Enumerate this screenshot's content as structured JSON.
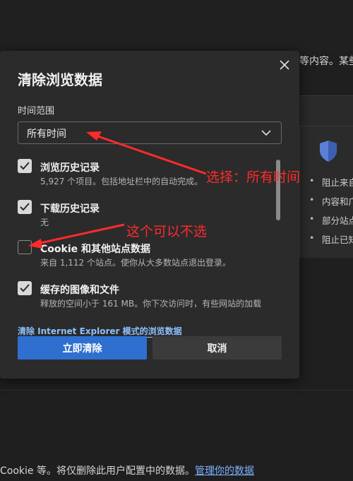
{
  "background": {
    "intro_text": "等内容。某些",
    "list_items": [
      "阻止来自",
      "内容和广",
      "部分站点",
      "阻止已知"
    ],
    "footer_text": "Cookie 等。将仅删除此用户配置中的数据。",
    "footer_link": "管理你的数据"
  },
  "dialog": {
    "title": "清除浏览数据",
    "time_range_label": "时间范围",
    "time_range_value": "所有时间",
    "items": [
      {
        "title": "浏览历史记录",
        "desc": "5,927 个项目。包括地址栏中的自动完成。",
        "checked": true
      },
      {
        "title": "下载历史记录",
        "desc": "无",
        "checked": true
      },
      {
        "title": "Cookie 和其他站点数据",
        "desc": "来自 1,112 个站点。使你从大多数站点退出登录。",
        "checked": false
      },
      {
        "title": "缓存的图像和文件",
        "desc": "释放的空间小于 161 MB。你下次访问时，有些网站的加载",
        "checked": true
      }
    ],
    "ie_link": "清除 Internet Explorer 模式的浏览数据",
    "clear_button": "立即清除",
    "cancel_button": "取消"
  },
  "annotations": {
    "select_all_time": "选择：所有时间",
    "no_need": "这个可以不选",
    "color": "#ff2b2b"
  },
  "icons": {
    "close": "close-icon",
    "chevron": "chevron-down-icon",
    "check": "checkmark-icon",
    "shield": "shield-icon"
  },
  "colors": {
    "accent": "#2f6fcf",
    "link": "#8cc0ff",
    "dialog_bg": "#2b2b2b"
  }
}
